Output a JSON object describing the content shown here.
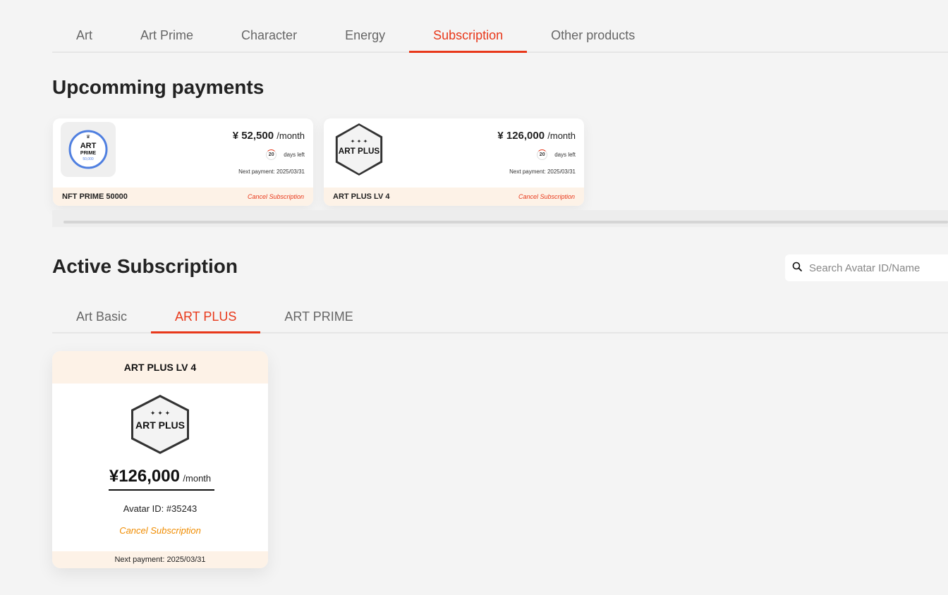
{
  "top_tabs": [
    {
      "label": "Art",
      "active": false
    },
    {
      "label": "Art Prime",
      "active": false
    },
    {
      "label": "Character",
      "active": false
    },
    {
      "label": "Energy",
      "active": false
    },
    {
      "label": "Subscription",
      "active": true
    },
    {
      "label": "Other products",
      "active": false
    }
  ],
  "upcoming": {
    "title": "Upcomming payments",
    "cards": [
      {
        "price": "¥ 52,500",
        "per": "/month",
        "days": "20",
        "days_label": "days left",
        "next_payment": "Next payment: 2025/03/31",
        "name": "NFT PRIME 50000",
        "cancel_label": "Cancel Subscription",
        "logo": {
          "line1": "ART",
          "line2": "PRIME",
          "line3": "50,000"
        }
      },
      {
        "price": "¥ 126,000",
        "per": "/month",
        "days": "20",
        "days_label": "days left",
        "next_payment": "Next payment: 2025/03/31",
        "name": "ART PLUS LV 4",
        "cancel_label": "Cancel Subscription",
        "logo": {
          "stars": "✦ ✦ ✦",
          "text": "ART PLUS"
        }
      }
    ]
  },
  "active": {
    "title": "Active Subscription",
    "search_placeholder": "Search Avatar ID/Name",
    "tabs": [
      {
        "label": "Art Basic",
        "active": false
      },
      {
        "label": "ART PLUS",
        "active": true
      },
      {
        "label": "ART PRIME",
        "active": false
      }
    ],
    "card": {
      "title": "ART PLUS LV 4",
      "logo": {
        "stars": "✦ ✦ ✦",
        "text": "ART PLUS"
      },
      "price": "¥126,000",
      "per": "/month",
      "avatar_id": "Avatar ID: #35243",
      "cancel_label": "Cancel Subscription",
      "next_payment": "Next payment: 2025/03/31"
    }
  },
  "colors": {
    "accent": "#e8381a",
    "cancel_orange": "#f08c00",
    "card_header": "#fdf2e7"
  }
}
